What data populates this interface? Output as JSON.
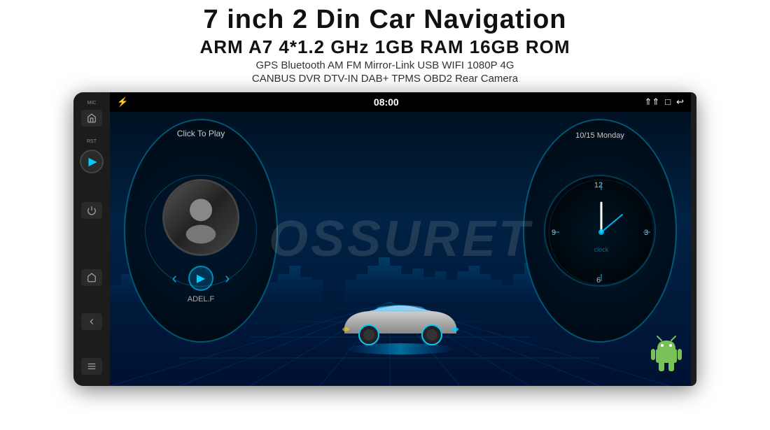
{
  "header": {
    "title": "7 inch 2 Din Car Navigation",
    "specs": "ARM A7 4*1.2 GHz    1GB RAM    16GB ROM",
    "features1": "GPS   Bluetooth   AM   FM   Mirror-Link   USB   WIFI   1080P   4G",
    "features2": "CANBUS    DVR    DTV-IN    DAB+    TPMS    OBD2    Rear Camera"
  },
  "device": {
    "watermark": "OSSURET",
    "status": {
      "time": "08:00",
      "bluetooth_icon": "⚡",
      "icons_right": [
        "⇑⇑",
        "□",
        "↩"
      ]
    },
    "music_player": {
      "click_to_play": "Click To Play",
      "song": "ADEL.F",
      "prev_label": "‹",
      "play_label": "▶",
      "next_label": "›"
    },
    "clock": {
      "date": "10/15 Monday",
      "label": "clock",
      "numbers": {
        "12": "12",
        "3": "3",
        "6": "6",
        "9": "9"
      }
    },
    "left_panel": {
      "mic_label": "MIC",
      "rst_label": "RST",
      "buttons": [
        "⌂",
        "↩",
        "⊕"
      ]
    }
  },
  "colors": {
    "accent_cyan": "#00ccff",
    "bg_dark": "#001122",
    "text_white": "#ffffff",
    "text_gray": "#cccccc"
  }
}
